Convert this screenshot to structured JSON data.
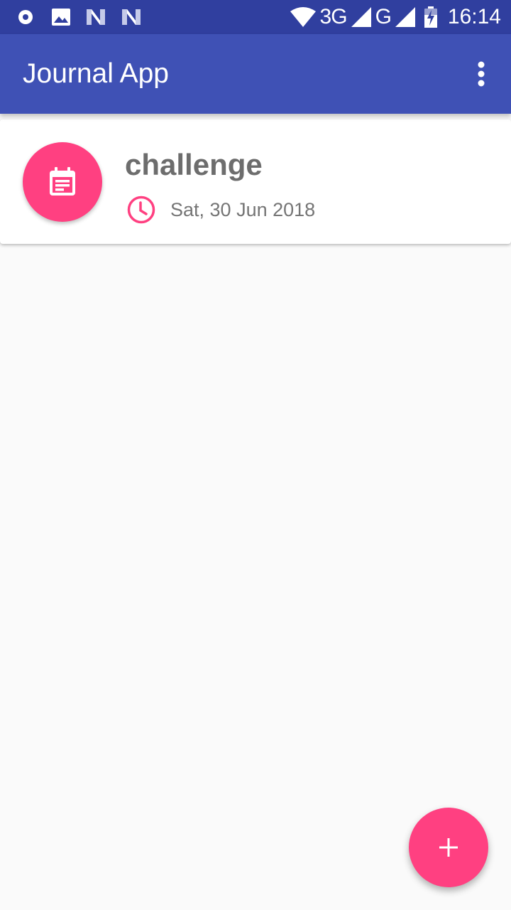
{
  "status_bar": {
    "left_icons": [
      "record-icon",
      "image-icon",
      "notification-n-icon",
      "notification-n-icon"
    ],
    "network_3g": "3G",
    "network_g": "G",
    "time": "16:14"
  },
  "app_bar": {
    "title": "Journal App",
    "overflow_icon": "more-vert-icon"
  },
  "entries": [
    {
      "title": "challenge",
      "date": "Sat, 30 Jun 2018",
      "avatar_icon": "journal-entry-icon",
      "date_icon": "clock-icon"
    }
  ],
  "fab": {
    "icon": "plus-icon"
  },
  "colors": {
    "status_bar": "#303f9f",
    "primary": "#3f51b5",
    "accent": "#ff4081",
    "background": "#fafafa",
    "card": "#ffffff",
    "title_text": "#6d6d6d",
    "date_text": "#757575"
  }
}
